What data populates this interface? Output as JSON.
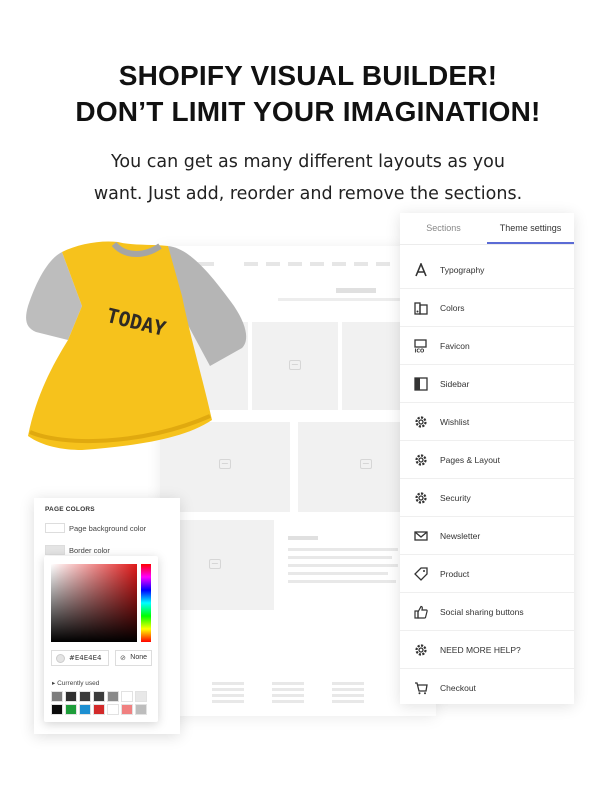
{
  "hero": {
    "title_line1": "SHOPIFY VISUAL BUILDER!",
    "title_line2": "DON’T LIMIT YOUR IMAGINATION!",
    "subtitle_line1": "You can get as many different layouts as you",
    "subtitle_line2": "want. Just add, reorder and remove the sections."
  },
  "shirt": {
    "print_text": "TODAY",
    "body_color": "#f6c21c",
    "sleeve_color": "#bdbdbd"
  },
  "settings_panel": {
    "tabs": [
      {
        "label": "Sections",
        "active": false
      },
      {
        "label": "Theme settings",
        "active": true
      }
    ],
    "accent_color": "#5b6bd5",
    "items": [
      {
        "label": "Typography",
        "icon": "typography-icon"
      },
      {
        "label": "Colors",
        "icon": "colors-icon"
      },
      {
        "label": "Favicon",
        "icon": "favicon-icon"
      },
      {
        "label": "Sidebar",
        "icon": "sidebar-icon"
      },
      {
        "label": "Wishlist",
        "icon": "gear-icon"
      },
      {
        "label": "Pages & Layout",
        "icon": "gear-icon"
      },
      {
        "label": "Security",
        "icon": "gear-icon"
      },
      {
        "label": "Newsletter",
        "icon": "envelope-icon"
      },
      {
        "label": "Product",
        "icon": "tag-icon"
      },
      {
        "label": "Social sharing buttons",
        "icon": "thumbs-up-icon"
      },
      {
        "label": "NEED MORE HELP?",
        "icon": "gear-icon"
      },
      {
        "label": "Checkout",
        "icon": "cart-icon"
      }
    ]
  },
  "page_colors": {
    "title": "PAGE COLORS",
    "page_background_label": "Page background color",
    "border_color_label": "Border color",
    "picker": {
      "hex_value": "#E4E4E4",
      "none_label": "None",
      "currently_used_label": "Currently used",
      "swatches": [
        "#7d7d7d",
        "#2f2f2f",
        "#3a3a3a",
        "#3b3b3b",
        "#8a8a8a",
        "#ffffff",
        "#e8e8e8",
        "#0a0a0a",
        "#1e9d3a",
        "#1d8fd1",
        "#d32a2a",
        "#ffffff",
        "#f08080",
        "#bdbdbd"
      ]
    }
  }
}
